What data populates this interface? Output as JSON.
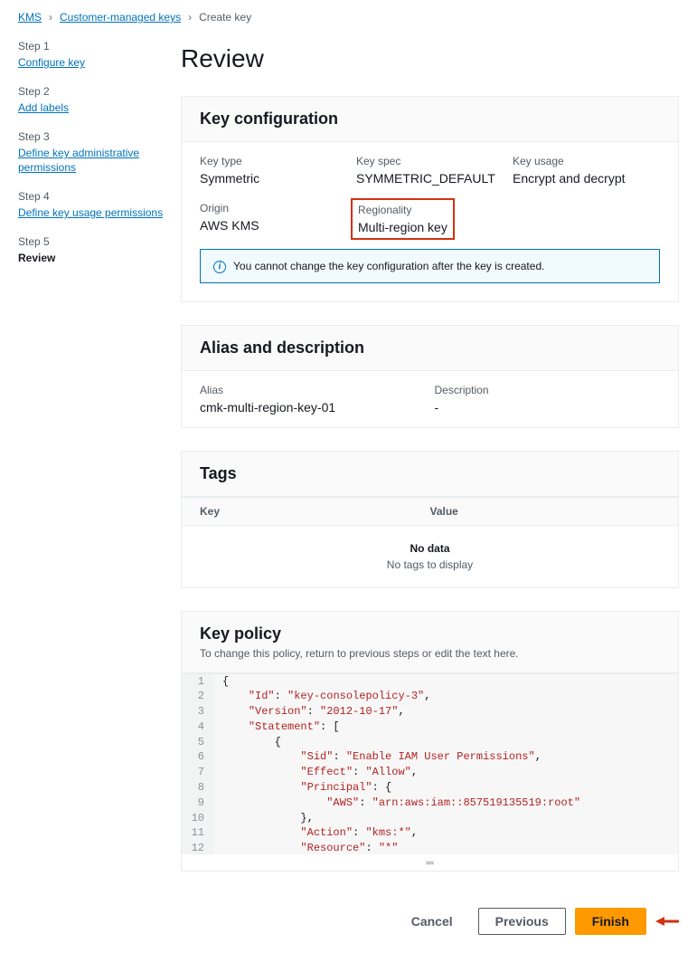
{
  "breadcrumb": {
    "items": [
      "KMS",
      "Customer-managed keys",
      "Create key"
    ]
  },
  "sidebar": {
    "steps": [
      {
        "label": "Step 1",
        "title": "Configure key",
        "active": false
      },
      {
        "label": "Step 2",
        "title": "Add labels",
        "active": false
      },
      {
        "label": "Step 3",
        "title": "Define key administrative permissions",
        "active": false
      },
      {
        "label": "Step 4",
        "title": "Define key usage permissions",
        "active": false
      },
      {
        "label": "Step 5",
        "title": "Review",
        "active": true
      }
    ]
  },
  "page": {
    "title": "Review"
  },
  "keyconfig": {
    "heading": "Key configuration",
    "items": {
      "keytype": {
        "label": "Key type",
        "value": "Symmetric"
      },
      "keyspec": {
        "label": "Key spec",
        "value": "SYMMETRIC_DEFAULT"
      },
      "keyusage": {
        "label": "Key usage",
        "value": "Encrypt and decrypt"
      },
      "origin": {
        "label": "Origin",
        "value": "AWS KMS"
      },
      "regionality": {
        "label": "Regionality",
        "value": "Multi-region key"
      }
    },
    "alert": "You cannot change the key configuration after the key is created."
  },
  "aliasdesc": {
    "heading": "Alias and description",
    "alias": {
      "label": "Alias",
      "value": "cmk-multi-region-key-01"
    },
    "desc": {
      "label": "Description",
      "value": "-"
    }
  },
  "tags": {
    "heading": "Tags",
    "col1": "Key",
    "col2": "Value",
    "nodata_title": "No data",
    "nodata_sub": "No tags to display"
  },
  "keypolicy": {
    "heading": "Key policy",
    "sub": "To change this policy, return to previous steps or edit the text here.",
    "code": [
      "{",
      "    \"Id\": \"key-consolepolicy-3\",",
      "    \"Version\": \"2012-10-17\",",
      "    \"Statement\": [",
      "        {",
      "            \"Sid\": \"Enable IAM User Permissions\",",
      "            \"Effect\": \"Allow\",",
      "            \"Principal\": {",
      "                \"AWS\": \"arn:aws:iam::857519135519:root\"",
      "            },",
      "            \"Action\": \"kms:*\",",
      "            \"Resource\": \"*\"",
      "        }",
      "    ]"
    ]
  },
  "footer": {
    "cancel": "Cancel",
    "previous": "Previous",
    "finish": "Finish"
  }
}
